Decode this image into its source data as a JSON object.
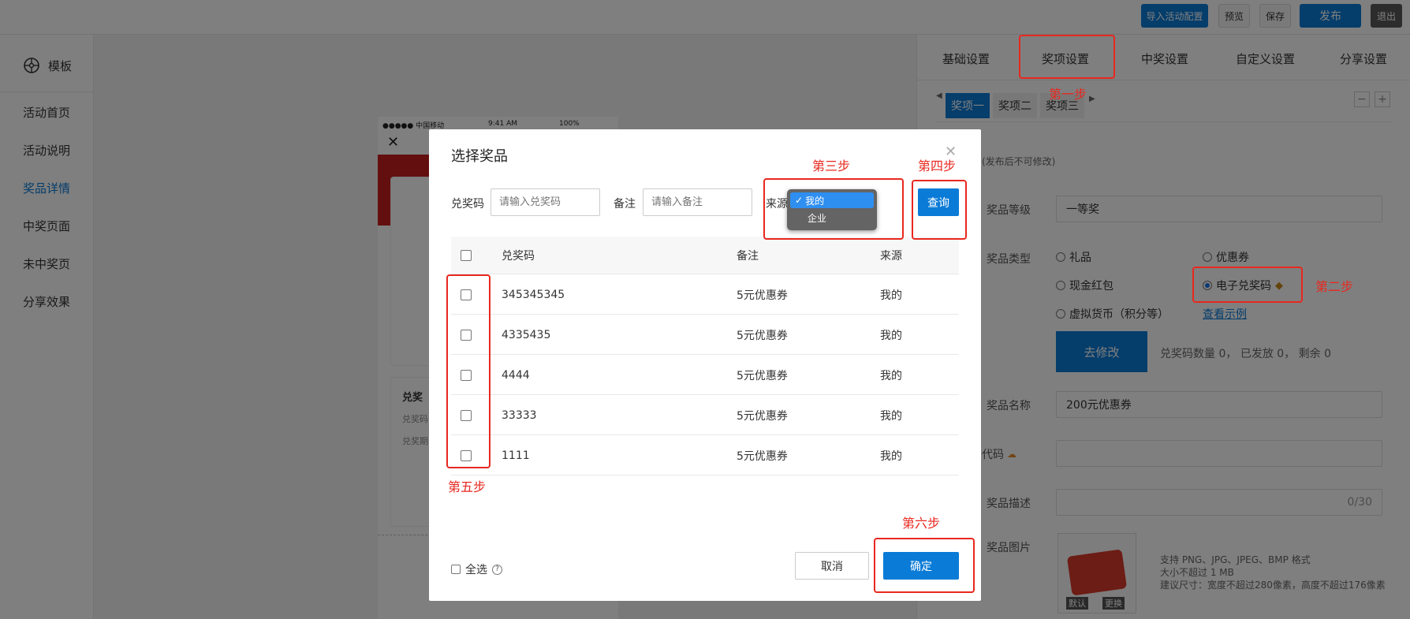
{
  "topbar": {
    "import_label": "导入活动配置",
    "preview_label": "预览",
    "save_label": "保存",
    "publish_label": "发布",
    "exit_label": "退出"
  },
  "sidebar": {
    "title": "模板",
    "items": [
      {
        "label": "活动首页"
      },
      {
        "label": "活动说明"
      },
      {
        "label": "奖品详情"
      },
      {
        "label": "中奖页面"
      },
      {
        "label": "未中奖页"
      },
      {
        "label": "分享效果"
      }
    ]
  },
  "phone": {
    "carrier": "●●●●● 中国移动",
    "time": "9:41 AM",
    "battery": "100%",
    "card_title": "兑奖",
    "card_line1": "兑奖码",
    "card_line2": "兑奖期"
  },
  "tabs": [
    {
      "label": "基础设置"
    },
    {
      "label": "奖项设置"
    },
    {
      "label": "中奖设置"
    },
    {
      "label": "自定义设置"
    },
    {
      "label": "分享设置"
    }
  ],
  "prize_tabs": [
    {
      "label": "奖项一"
    },
    {
      "label": "奖项二"
    },
    {
      "label": "奖项三"
    }
  ],
  "panel": {
    "hint": "(发布后不可修改)",
    "level_label": "奖品等级",
    "level_value": "一等奖",
    "type_label": "奖品类型",
    "type_options": [
      "礼品",
      "优惠券",
      "现金红包",
      "电子兑奖码",
      "虚拟货币（积分等）"
    ],
    "view_example": "查看示例",
    "modify_button": "去修改",
    "code_count_label": "兑奖码数量",
    "code_count": "0",
    "issued_label": "已发放",
    "issued": "0",
    "remaining_label": "剩余",
    "remaining": "0",
    "name_label": "奖品名称",
    "name_value": "200元优惠券",
    "code_label": "代码",
    "desc_label": "奖品描述",
    "desc_counter": "0/30",
    "image_label": "奖品图片",
    "image_default": "默认",
    "image_replace": "更换",
    "image_hint1": "支持 PNG、JPG、JPEG、BMP 格式",
    "image_hint2": "大小不超过 1 MB",
    "image_hint3": "建议尺寸：宽度不超过280像素，高度不超过176像素"
  },
  "modal": {
    "title": "选择奖品",
    "code_label": "兑奖码",
    "code_placeholder": "请输入兑奖码",
    "remark_label": "备注",
    "remark_placeholder": "请输入备注",
    "source_label": "来源",
    "source_options": [
      "我的",
      "企业"
    ],
    "source_selected": "我的",
    "query_button": "查询",
    "columns": [
      "兑奖码",
      "备注",
      "来源"
    ],
    "rows": [
      {
        "code": "345345345",
        "remark": "5元优惠券",
        "source": "我的"
      },
      {
        "code": "4335435",
        "remark": "5元优惠券",
        "source": "我的"
      },
      {
        "code": "4444",
        "remark": "5元优惠券",
        "source": "我的"
      },
      {
        "code": "33333",
        "remark": "5元优惠券",
        "source": "我的"
      },
      {
        "code": "1111",
        "remark": "5元优惠券",
        "source": "我的"
      }
    ],
    "select_all": "全选",
    "cancel_button": "取消",
    "confirm_button": "确定"
  },
  "annotations": {
    "step1": "第一步",
    "step2": "第二步",
    "step3": "第三步",
    "step4": "第四步",
    "step5": "第五步",
    "step6": "第六步"
  },
  "colors": {
    "accent": "#0a7bd6",
    "annotation": "#e8281f",
    "sidebar_active": "#0a7bd6"
  }
}
